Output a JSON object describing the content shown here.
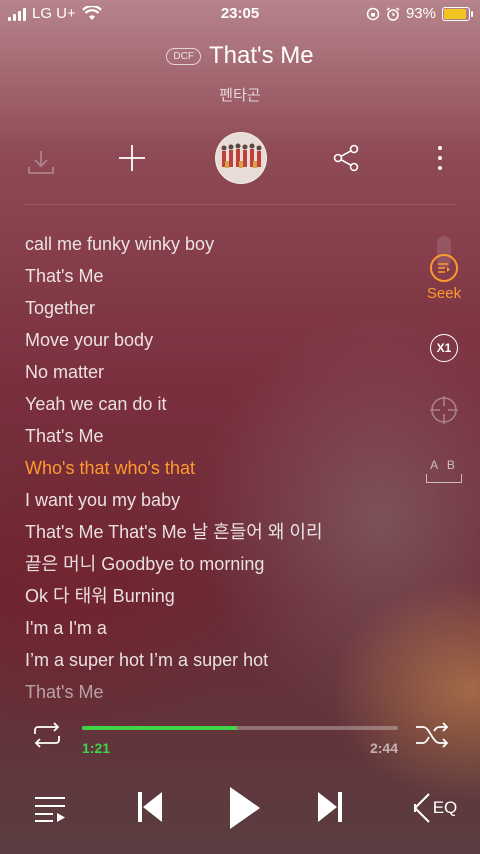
{
  "status_bar": {
    "carrier": "LG U+",
    "time": "23:05",
    "battery": "93%",
    "battery_level": 0.93
  },
  "track": {
    "badge": "DCF",
    "title": "That's Me",
    "artist": "펜타곤"
  },
  "lyrics": [
    "call me funky winky boy",
    "That's Me",
    "Together",
    "Move your body",
    "No matter",
    "Yeah we can do it",
    "That's Me",
    "Who's that who's that",
    "I want you my baby",
    "That's Me That's Me 날 흔들어 왜 이리",
    "끝은 머니 Goodbye to morning",
    "Ok 다 태워 Burning",
    "I'm a I'm a",
    "I’m a super hot I’m a super hot",
    "That's Me"
  ],
  "active_lyric_index": 7,
  "side_controls": {
    "seek_label": "Seek",
    "speed_label": "X1",
    "ab_label": "A B"
  },
  "playback": {
    "elapsed": "1:21",
    "duration": "2:44",
    "progress": 0.49
  },
  "eq_label": "EQ",
  "colors": {
    "accent": "#ff9a2e",
    "progress": "#3fd44a",
    "battery": "#f3c522"
  }
}
